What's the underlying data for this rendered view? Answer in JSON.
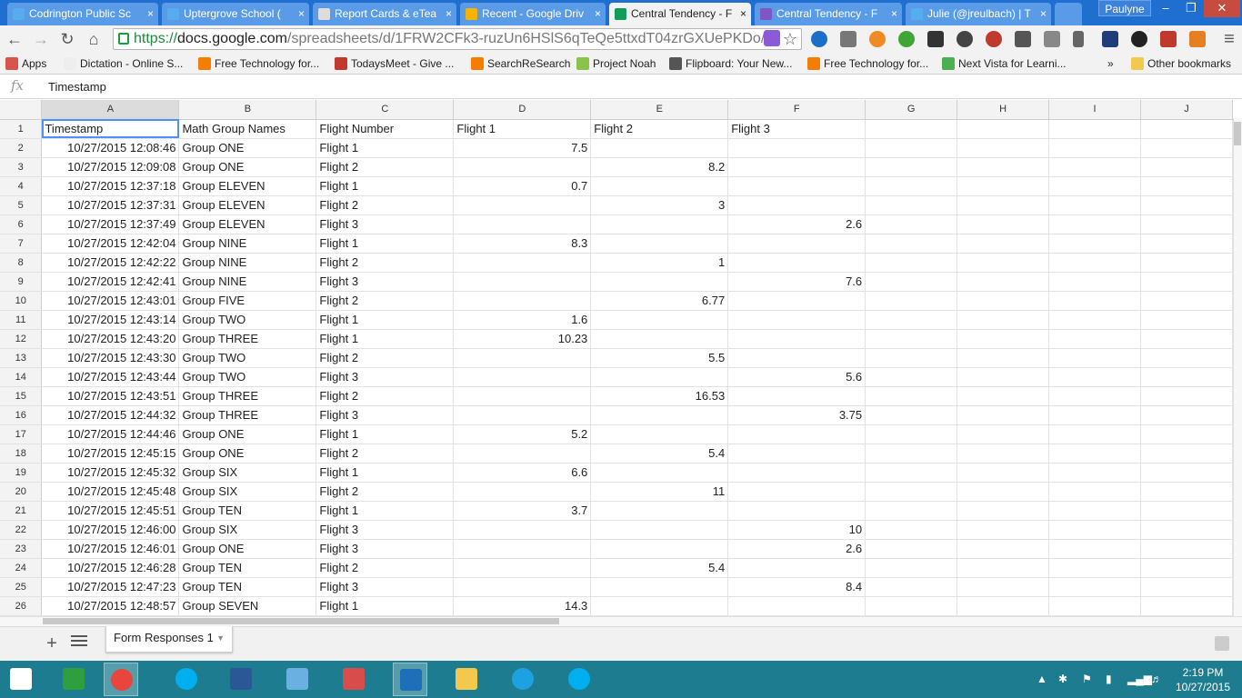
{
  "browser": {
    "tabs": [
      {
        "title": "Codrington Public Sc",
        "icon": "twitter-icon",
        "color": "#ffffff"
      },
      {
        "title": "Uptergrove School (",
        "icon": "twitter-icon",
        "color": "#ffffff"
      },
      {
        "title": "Report Cards & eTea",
        "icon": "page-icon",
        "color": "#ffffff"
      },
      {
        "title": "Recent - Google Driv",
        "icon": "drive-icon",
        "color": "#ffffff"
      },
      {
        "title": "Central Tendency - F",
        "icon": "sheets-icon",
        "color": "#222222"
      },
      {
        "title": "Central Tendency - F",
        "icon": "forms-icon",
        "color": "#ffffff"
      },
      {
        "title": "Julie (@jreulbach) | T",
        "icon": "twitter-icon",
        "color": "#ffffff"
      }
    ],
    "profile": "Paulyne",
    "url_proto": "https://",
    "url_host": "docs.google.com",
    "url_path": "/spreadsheets/d/1FRW2CFk3-ruzUn6HSlS6qTeQe5ttxdT04zrGXUePKDo/e",
    "bookmarks": [
      {
        "label": "Apps",
        "icon": "apps-icon"
      },
      {
        "label": "Dictation - Online S...",
        "icon": "page-icon"
      },
      {
        "label": "Free Technology for...",
        "icon": "blogger-icon"
      },
      {
        "label": "TodaysMeet - Give ...",
        "icon": "todaysmeet-icon"
      },
      {
        "label": "SearchReSearch",
        "icon": "blogger-icon"
      },
      {
        "label": "Project Noah",
        "icon": "leaf-icon"
      },
      {
        "label": "Flipboard: Your New...",
        "icon": "play-icon"
      },
      {
        "label": "Free Technology for...",
        "icon": "blogger-icon"
      },
      {
        "label": "Next Vista for Learni...",
        "icon": "nextvista-icon"
      }
    ],
    "bookmarks_more": "»",
    "other_bookmarks": "Other bookmarks"
  },
  "sheet": {
    "formula_label": "fx",
    "formula_value": "Timestamp",
    "columns": [
      "A",
      "B",
      "C",
      "D",
      "E",
      "F",
      "G",
      "H",
      "I",
      "J"
    ],
    "rows": [
      [
        "Timestamp",
        "Math Group Names",
        "Flight Number",
        "Flight 1",
        "Flight 2",
        "Flight 3"
      ],
      [
        "10/27/2015 12:08:46",
        "Group ONE",
        "Flight 1",
        "7.5",
        "",
        ""
      ],
      [
        "10/27/2015 12:09:08",
        "Group ONE",
        "Flight 2",
        "",
        "8.2",
        ""
      ],
      [
        "10/27/2015 12:37:18",
        "Group ELEVEN",
        "Flight 1",
        "0.7",
        "",
        ""
      ],
      [
        "10/27/2015 12:37:31",
        "Group ELEVEN",
        "Flight 2",
        "",
        "3",
        ""
      ],
      [
        "10/27/2015 12:37:49",
        "Group ELEVEN",
        "Flight 3",
        "",
        "",
        "2.6"
      ],
      [
        "10/27/2015 12:42:04",
        "Group NINE",
        "Flight 1",
        "8.3",
        "",
        ""
      ],
      [
        "10/27/2015 12:42:22",
        "Group NINE",
        "Flight 2",
        "",
        "1",
        ""
      ],
      [
        "10/27/2015 12:42:41",
        "Group NINE",
        "Flight 3",
        "",
        "",
        "7.6"
      ],
      [
        "10/27/2015 12:43:01",
        "Group FIVE",
        "Flight 2",
        "",
        "6.77",
        ""
      ],
      [
        "10/27/2015 12:43:14",
        "Group TWO",
        "Flight 1",
        "1.6",
        "",
        ""
      ],
      [
        "10/27/2015 12:43:20",
        "Group THREE",
        "Flight 1",
        "10.23",
        "",
        ""
      ],
      [
        "10/27/2015 12:43:30",
        "Group TWO",
        "Flight 2",
        "",
        "5.5",
        ""
      ],
      [
        "10/27/2015 12:43:44",
        "Group TWO",
        "Flight 3",
        "",
        "",
        "5.6"
      ],
      [
        "10/27/2015 12:43:51",
        "Group THREE",
        "Flight 2",
        "",
        "16.53",
        ""
      ],
      [
        "10/27/2015 12:44:32",
        "Group THREE",
        "Flight 3",
        "",
        "",
        "3.75"
      ],
      [
        "10/27/2015 12:44:46",
        "Group ONE",
        "Flight 1",
        "5.2",
        "",
        ""
      ],
      [
        "10/27/2015 12:45:15",
        "Group ONE",
        "Flight 2",
        "",
        "5.4",
        ""
      ],
      [
        "10/27/2015 12:45:32",
        "Group  SIX",
        "Flight 1",
        "6.6",
        "",
        ""
      ],
      [
        "10/27/2015 12:45:48",
        "Group  SIX",
        "Flight 2",
        "",
        "11",
        ""
      ],
      [
        "10/27/2015 12:45:51",
        "Group TEN",
        "Flight 1",
        "3.7",
        "",
        ""
      ],
      [
        "10/27/2015 12:46:00",
        "Group  SIX",
        "Flight 3",
        "",
        "",
        "10"
      ],
      [
        "10/27/2015 12:46:01",
        "Group ONE",
        "Flight 3",
        "",
        "",
        "2.6"
      ],
      [
        "10/27/2015 12:46:28",
        "Group TEN",
        "Flight 2",
        "",
        "5.4",
        ""
      ],
      [
        "10/27/2015 12:47:23",
        "Group TEN",
        "Flight 3",
        "",
        "",
        "8.4"
      ],
      [
        "10/27/2015 12:48:57",
        "Group SEVEN",
        "Flight 1",
        "14.3",
        "",
        ""
      ]
    ],
    "sheet_tab": "Form Responses 1",
    "add_sheet": "+"
  },
  "taskbar": {
    "apps": [
      {
        "name": "start-button",
        "icon": "windows-icon",
        "color": "#ffffff"
      },
      {
        "name": "store-app",
        "icon": "store-icon",
        "color": "#2e9e3e"
      },
      {
        "name": "chrome-app",
        "icon": "chrome-icon",
        "color": "#e8453c"
      },
      {
        "name": "skype-app",
        "icon": "skype-icon",
        "color": "#00aff0"
      },
      {
        "name": "word-app",
        "icon": "word-icon",
        "color": "#2b5797"
      },
      {
        "name": "notes-app",
        "icon": "notes-icon",
        "color": "#6ab0e0"
      },
      {
        "name": "paint-app",
        "icon": "paint-icon",
        "color": "#d94c4c"
      },
      {
        "name": "lync-app",
        "icon": "lync-icon",
        "color": "#1e6fb8"
      },
      {
        "name": "folder-app",
        "icon": "folder-icon",
        "color": "#f2c94c"
      },
      {
        "name": "ie-app",
        "icon": "ie-icon",
        "color": "#1ea1e1"
      },
      {
        "name": "skype-app-2",
        "icon": "skype-icon",
        "color": "#00aff0"
      }
    ],
    "time": "2:19 PM",
    "date": "10/27/2015"
  }
}
